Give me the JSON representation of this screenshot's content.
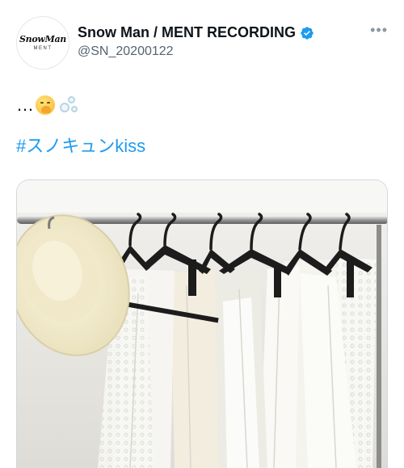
{
  "author": {
    "display_name": "Snow Man / MENT RECORDING",
    "handle": "@SN_20200122",
    "avatar_logo": "SnowMan",
    "avatar_sub": "MENT",
    "verified": true
  },
  "tweet": {
    "text": "…",
    "emoji": [
      "hand-over-mouth-face-icon",
      "bubbles-icon"
    ],
    "hashtag": "#スノキュンkiss"
  },
  "menu": {
    "more_label": "•••"
  },
  "colors": {
    "accent": "#1d9bf0",
    "text": "#0f1419",
    "secondary": "#536471"
  },
  "media": {
    "description_icon": "photo"
  }
}
